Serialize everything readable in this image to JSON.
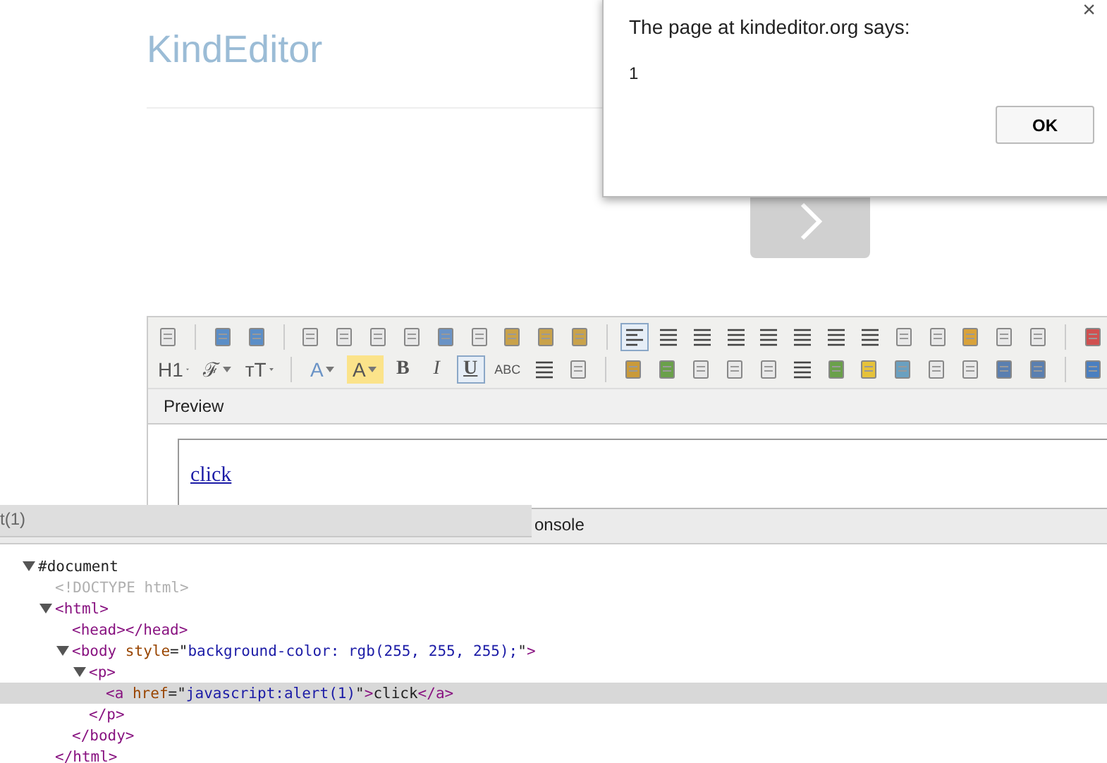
{
  "header": {
    "title": "KindEditor"
  },
  "toolbar": {
    "rows": [
      [
        {
          "kind": "button",
          "selected": false
        },
        {
          "kind": "separator"
        },
        {
          "kind": "button",
          "selected": false
        },
        {
          "kind": "button",
          "selected": false
        },
        {
          "kind": "separator"
        },
        {
          "kind": "button",
          "selected": false
        },
        {
          "kind": "button",
          "selected": false
        },
        {
          "kind": "button",
          "selected": false
        },
        {
          "kind": "button",
          "selected": false
        },
        {
          "kind": "button",
          "selected": false
        },
        {
          "kind": "button",
          "selected": false
        },
        {
          "kind": "button",
          "selected": false
        },
        {
          "kind": "button",
          "selected": false
        },
        {
          "kind": "button",
          "selected": false
        },
        {
          "kind": "separator"
        },
        {
          "kind": "button",
          "selected": true
        },
        {
          "kind": "button",
          "selected": false
        },
        {
          "kind": "button",
          "selected": false
        },
        {
          "kind": "button",
          "selected": false
        },
        {
          "kind": "button",
          "selected": false
        },
        {
          "kind": "button",
          "selected": false
        },
        {
          "kind": "button",
          "selected": false
        },
        {
          "kind": "button",
          "selected": false
        },
        {
          "kind": "button",
          "selected": false
        },
        {
          "kind": "button",
          "selected": false
        },
        {
          "kind": "button",
          "selected": false
        },
        {
          "kind": "button",
          "selected": false
        },
        {
          "kind": "button",
          "selected": false
        },
        {
          "kind": "separator"
        },
        {
          "kind": "button",
          "selected": false
        }
      ],
      [
        {
          "kind": "menu",
          "label": "H1",
          "selected": false
        },
        {
          "kind": "menu",
          "label": "ℱ",
          "selected": false
        },
        {
          "kind": "menu",
          "label": "ᴛT",
          "selected": false
        },
        {
          "kind": "separator"
        },
        {
          "kind": "menu",
          "label": "A",
          "selected": false
        },
        {
          "kind": "menu",
          "label": "A",
          "selected": false
        },
        {
          "kind": "text",
          "label": "B",
          "selected": false
        },
        {
          "kind": "text",
          "label": "I",
          "selected": false
        },
        {
          "kind": "text",
          "label": "U",
          "selected": true
        },
        {
          "kind": "text",
          "label": "ABC",
          "selected": false
        },
        {
          "kind": "button",
          "selected": false
        },
        {
          "kind": "button",
          "selected": false
        },
        {
          "kind": "separator"
        },
        {
          "kind": "button",
          "selected": false
        },
        {
          "kind": "button",
          "selected": false
        },
        {
          "kind": "button",
          "selected": false
        },
        {
          "kind": "button",
          "selected": false
        },
        {
          "kind": "button",
          "selected": false
        },
        {
          "kind": "button",
          "selected": false
        },
        {
          "kind": "button",
          "selected": false
        },
        {
          "kind": "button",
          "selected": false
        },
        {
          "kind": "button",
          "selected": false
        },
        {
          "kind": "button",
          "selected": false
        },
        {
          "kind": "button",
          "selected": false
        },
        {
          "kind": "button",
          "selected": false
        },
        {
          "kind": "button",
          "selected": false
        },
        {
          "kind": "separator"
        },
        {
          "kind": "button",
          "selected": false
        }
      ]
    ]
  },
  "preview": {
    "title": "Preview",
    "link": "click"
  },
  "devtools": {
    "panel_label": "t(1)",
    "tab": "onsole",
    "tree": [
      {
        "tokens": [
          {
            "kind": "text",
            "text": "#document"
          }
        ],
        "expanded": true,
        "children": [
          {
            "tokens": [
              {
                "kind": "doctype",
                "text": "<!DOCTYPE html>"
              }
            ]
          },
          {
            "tokens": [
              {
                "kind": "tag",
                "text": "<html>"
              }
            ],
            "expanded": true,
            "closing": "</html>",
            "children": [
              {
                "tokens": [
                  {
                    "kind": "tag",
                    "text": "<head></head>"
                  }
                ]
              },
              {
                "tokens": [
                  {
                    "kind": "tag",
                    "text": "<body"
                  },
                  {
                    "kind": "attr",
                    "text": " style"
                  },
                  {
                    "kind": "text",
                    "text": "=\""
                  },
                  {
                    "kind": "value",
                    "text": "background-color: rgb(255, 255, 255);"
                  },
                  {
                    "kind": "text",
                    "text": "\""
                  },
                  {
                    "kind": "tag",
                    "text": ">"
                  }
                ],
                "expanded": true,
                "closing": "</body>",
                "children": [
                  {
                    "tokens": [
                      {
                        "kind": "tag",
                        "text": "<p>"
                      }
                    ],
                    "expanded": true,
                    "closing": "</p>",
                    "children": [
                      {
                        "tokens": [
                          {
                            "kind": "tag",
                            "text": "<a"
                          },
                          {
                            "kind": "attr",
                            "text": " href"
                          },
                          {
                            "kind": "text",
                            "text": "=\""
                          },
                          {
                            "kind": "value",
                            "text": "javascript:alert(1)"
                          },
                          {
                            "kind": "text",
                            "text": "\""
                          },
                          {
                            "kind": "tag",
                            "text": ">"
                          },
                          {
                            "kind": "text",
                            "text": "click"
                          },
                          {
                            "kind": "tag",
                            "text": "</a>"
                          }
                        ],
                        "selected": true
                      }
                    ]
                  }
                ]
              }
            ]
          }
        ]
      }
    ]
  },
  "dialog": {
    "title": "The page at kindeditor.org says:",
    "message": "1",
    "close": "×",
    "button": "OK"
  }
}
